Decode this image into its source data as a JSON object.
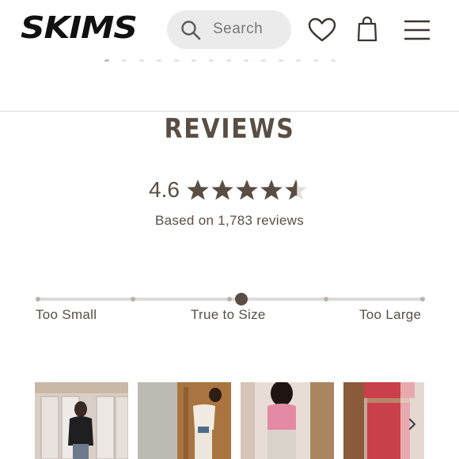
{
  "header": {
    "logo_text": "SKIMS",
    "search_placeholder": "Search",
    "icons": [
      "search-icon",
      "heart-icon",
      "shopping-bag-icon",
      "hamburger-menu-icon"
    ]
  },
  "carousel": {
    "dot_count": 14,
    "active_index": 0
  },
  "reviews": {
    "title": "REVIEWS",
    "average_rating": "4.6",
    "stars_out_of": 5,
    "based_on": "Based on 1,783 reviews"
  },
  "fit": {
    "labels": [
      "Too Small",
      "True to Size",
      "Too Large"
    ],
    "positions": 5,
    "selected_fraction": 0.53
  },
  "photos": {
    "items": [
      {
        "name": "review-photo-1"
      },
      {
        "name": "review-photo-2"
      },
      {
        "name": "review-photo-3"
      },
      {
        "name": "review-photo-4"
      }
    ],
    "next_icon": "chevron-right-icon"
  },
  "colors": {
    "brand_text": "#5a4e44",
    "search_bg": "#ebebeb"
  }
}
